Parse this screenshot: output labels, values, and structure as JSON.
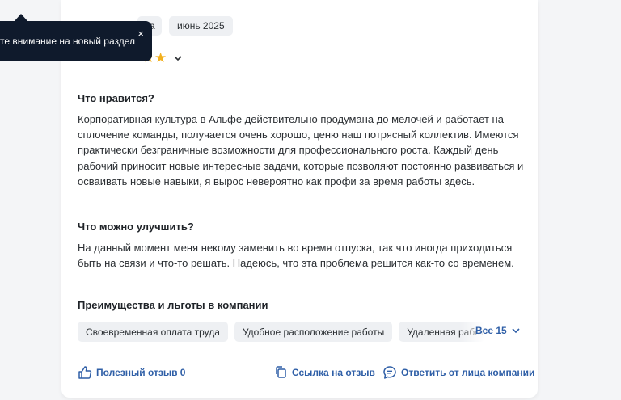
{
  "top_fragment": "",
  "date_chip_left": "да",
  "date_chip": "июнь 2025",
  "tooltip": {
    "text": "те внимание на новый раздел",
    "close": "×"
  },
  "rating": {
    "stars_shown": 2
  },
  "review": {
    "likes_heading": "Что нравится?",
    "likes_text": "Корпоративная культура в Альфе действительно продумана до мелочей и работает на сплочение команды, получается очень хорошо, ценю наш потрясный коллектив. Имеются практически безграничные возможности для профессионального роста. Каждый день рабочий приносит новые интересные задачи, которые позволяют постоянно развиваться и осваивать новые навыки, я вырос невероятно как профи за время работы здесь.",
    "improve_heading": "Что можно улучшить?",
    "improve_text": "На данный момент меня некому заменить во время отпуска, так что иногда приходиться быть на связи и что-то решать. Надеюсь, что эта проблема решится как-то со временем."
  },
  "benefits": {
    "heading": "Преимущества и льготы в компании",
    "chips": [
      "Своевременная оплата труда",
      "Удобное расположение работы",
      "Удаленная работа"
    ],
    "all_label": "Все 15"
  },
  "actions": {
    "helpful": "Полезный отзыв 0",
    "link": "Ссылка на отзыв",
    "reply": "Ответить от лица компании"
  },
  "colors": {
    "accent": "#2f5fa7",
    "star": "#f2b01e",
    "tooltip_bg": "#0f1a2c",
    "chip_bg": "#eef0f3"
  }
}
